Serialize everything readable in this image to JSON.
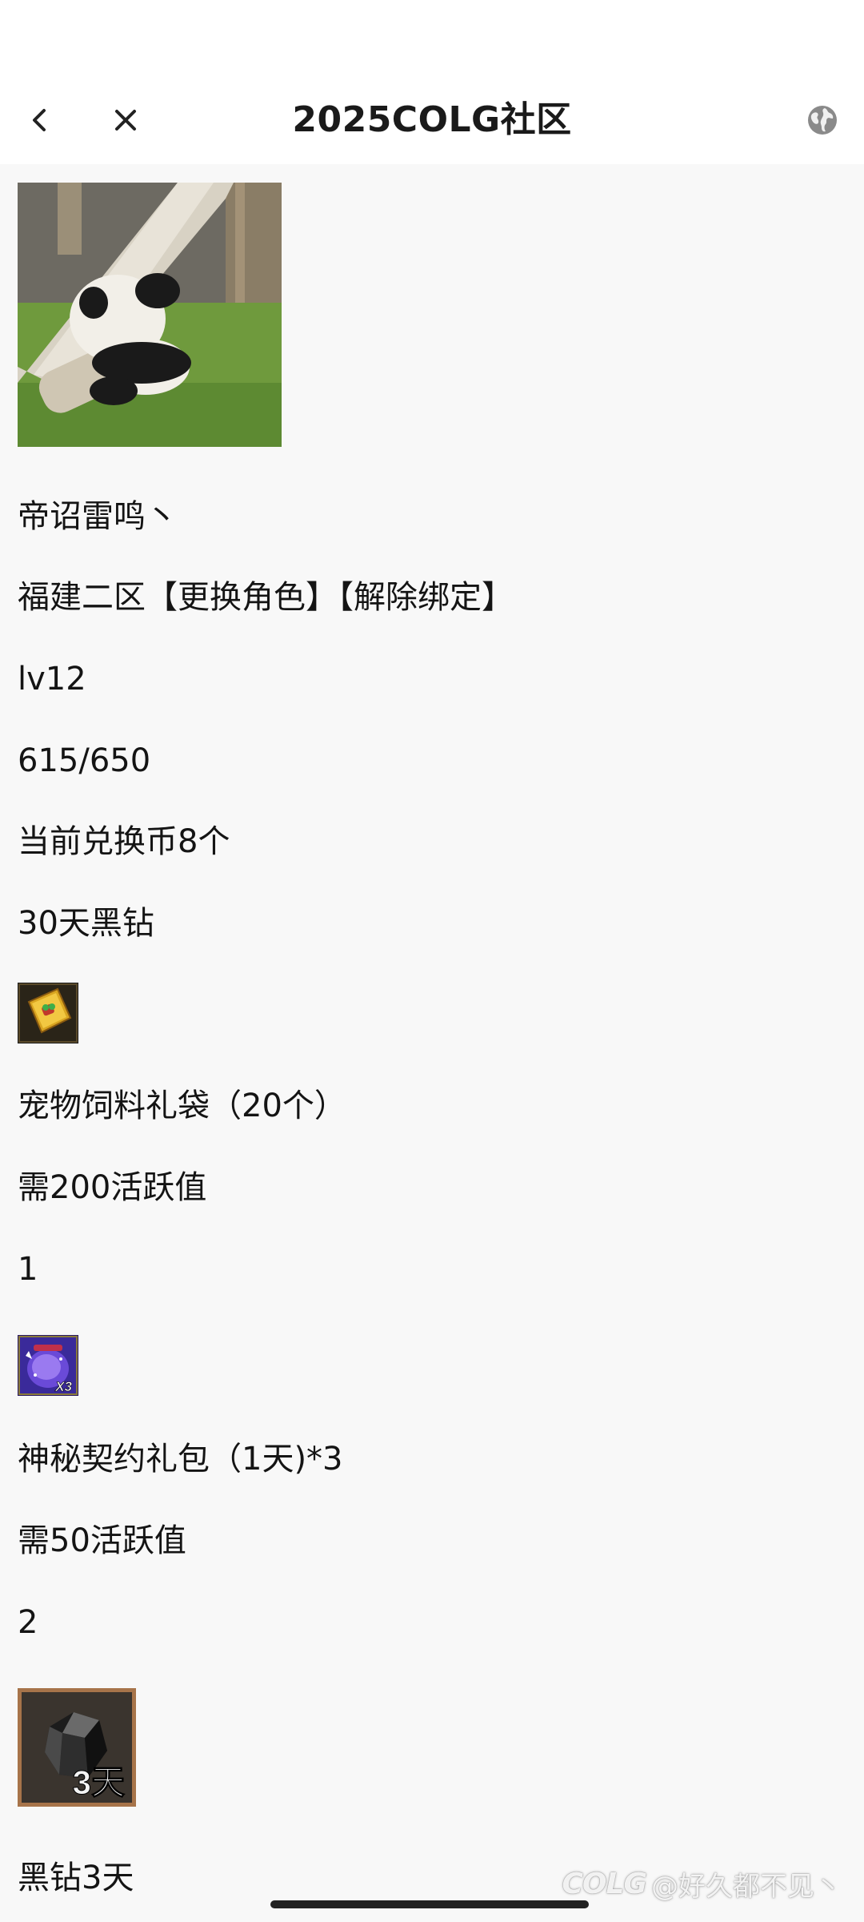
{
  "header": {
    "title": "2025COLG社区",
    "back_icon": "chevron-left-icon",
    "close_icon": "close-icon",
    "globe_icon": "globe-icon"
  },
  "profile": {
    "name": "帝诏雷鸣丶",
    "server": "福建二区【更换角色】【解除绑定】",
    "level": "lv12",
    "activity": "615/650",
    "coins": "当前兑换币8个",
    "reward_title": "30天黑钻"
  },
  "items": [
    {
      "icon": "gift-bag-icon",
      "name": "宠物饲料礼袋（20个）",
      "requirement": "需200活跃值",
      "count": "1"
    },
    {
      "icon": "contract-package-icon",
      "icon_badge": "X3",
      "name": "神秘契约礼包（1天)*3",
      "requirement": "需50活跃值",
      "count": "2"
    },
    {
      "icon": "black-diamond-icon",
      "icon_badge": "3天",
      "name": "黑钻3天"
    }
  ],
  "watermark": {
    "logo": "COLG",
    "handle": "@好久都不见丶"
  },
  "colors": {
    "page_bg": "#f8f8f8",
    "header_bg": "#ffffff",
    "text": "#141414"
  }
}
